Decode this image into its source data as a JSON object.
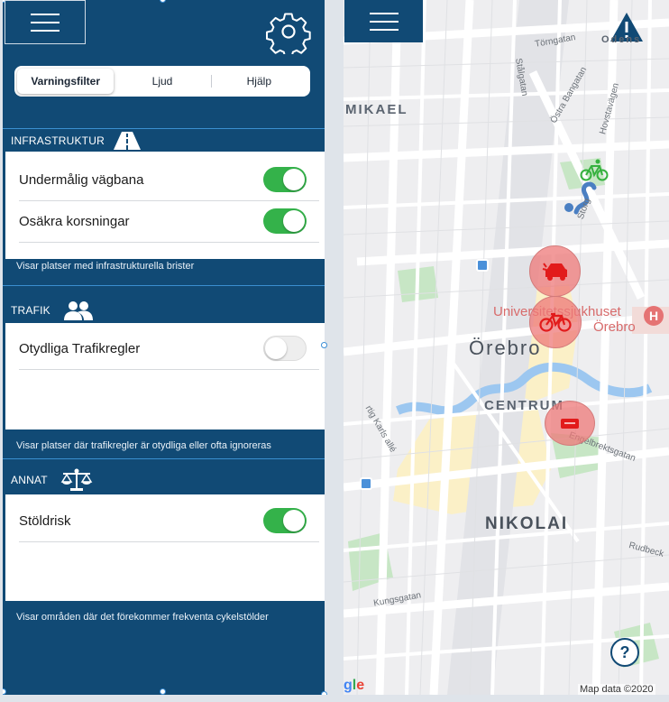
{
  "settings": {
    "tabs": [
      {
        "label": "Varningsfilter",
        "active": true
      },
      {
        "label": "Ljud",
        "active": false
      },
      {
        "label": "Hjälp",
        "active": false
      }
    ],
    "sections": [
      {
        "title": "INFRASTRUKTUR",
        "icon": "road-icon",
        "toggles": [
          {
            "label": "Undermålig vägbana",
            "on": true
          },
          {
            "label": "Osäkra korsningar",
            "on": true
          }
        ],
        "description": "Visar platser med infrastrukturella brister"
      },
      {
        "title": "TRAFIK",
        "icon": "people-icon",
        "toggles": [
          {
            "label": "Otydliga Trafikregler",
            "on": false
          }
        ],
        "description": "Visar platser där trafikregler är otydliga eller ofta ignoreras"
      },
      {
        "title": "ANNAT",
        "icon": "scales-icon",
        "toggles": [
          {
            "label": "Stöldrisk",
            "on": true
          }
        ],
        "description": "Visar områden där det förekommer frekventa cykelstölder"
      }
    ]
  },
  "map": {
    "districts": [
      "MIKAEL",
      "Örebro",
      "CENTRUM",
      "NIKOLAI"
    ],
    "streets": [
      "Törngatan",
      "Stålgatan",
      "Östra Bangatan",
      "Hovstavägen",
      "Storg",
      "Engelbrektsgatan",
      "Kungsgatan",
      "Rudbeck",
      "rtig Karls allé",
      "Odens"
    ],
    "hospital": "Universitetssjukhuset Örebro",
    "hospital_label_1": "Universitetssjukhuset",
    "hospital_label_2": "Örebro",
    "attribution": "Map data ©2020",
    "logo_text": "gle",
    "help_label": "?",
    "markers": [
      "car-crash-icon",
      "bicycle-icon",
      "pothole-icon"
    ]
  },
  "colors": {
    "panel": "#114a75",
    "toggle_on": "#34b24a",
    "marker": "#ee7878",
    "park": "#c7e6c5",
    "water": "#9cc7f0",
    "downtown": "#fbf0c7"
  }
}
